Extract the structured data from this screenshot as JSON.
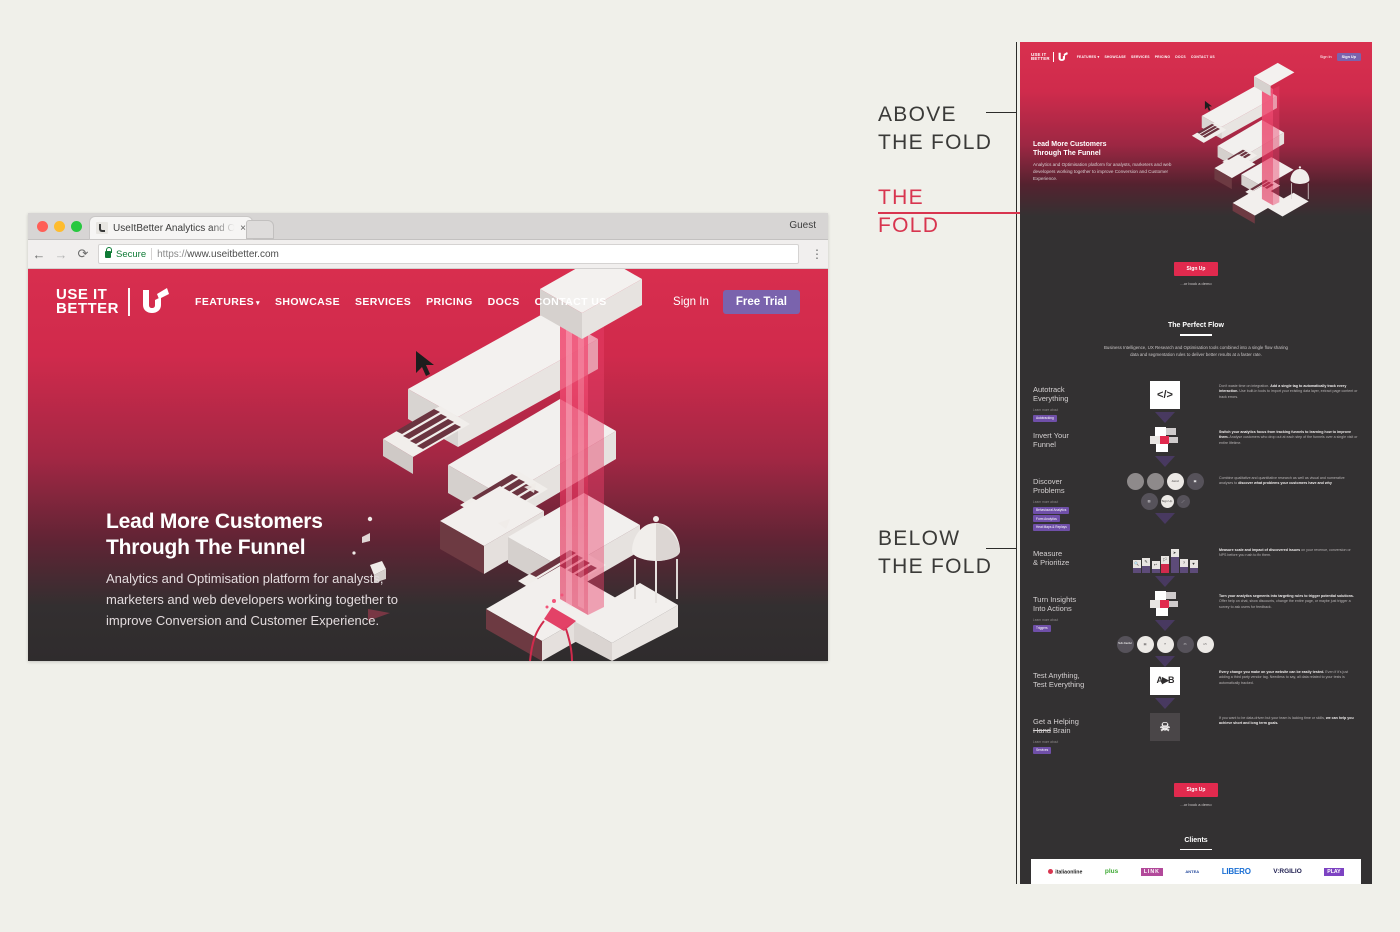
{
  "browser": {
    "tab_title": "UseItBetter Analytics and Opti",
    "tab_close": "×",
    "profile_label": "Guest",
    "back_icon": "←",
    "forward_icon": "→",
    "reload_icon": "⟳",
    "secure_label": "Secure",
    "url_scheme": "https://",
    "url_host": "www.useitbetter.com",
    "menu_icon": "⋮"
  },
  "site": {
    "logo_line1": "USE IT",
    "logo_line2": "BETTER",
    "nav": [
      {
        "label": "FEATURES",
        "has_caret": true
      },
      {
        "label": "SHOWCASE",
        "has_caret": false
      },
      {
        "label": "SERVICES",
        "has_caret": false
      },
      {
        "label": "PRICING",
        "has_caret": false
      },
      {
        "label": "DOCS",
        "has_caret": false
      },
      {
        "label": "CONTACT US",
        "has_caret": false
      }
    ],
    "sign_in": "Sign In",
    "cta_primary": "Free Trial",
    "cta_signup": "Sign Up",
    "hero": {
      "title_line1": "Lead More Customers",
      "title_line2": "Through The Funnel",
      "paragraph": "Analytics and Optimisation platform for analysts, marketers and web developers working together to improve Conversion and Customer Experience."
    }
  },
  "annotations": {
    "above_line1": "ABOVE",
    "above_line2": "THE FOLD",
    "fold_line1": "THE",
    "fold_line2": "FOLD",
    "below_line1": "BELOW",
    "below_line2": "THE FOLD",
    "fold_color": "#d8354f",
    "text_color": "#3a3a38"
  },
  "thumbnail": {
    "cta_button": "Sign Up",
    "cta_sub": "...or book a demo",
    "section_title": "The Perfect Flow",
    "section_sub": "Business Intelligence, UX Research and Optimisation tools combined into a single flow sharing data and segmentation rules to deliver better results at a faster rate.",
    "learn_more": "Learn more about",
    "features": [
      {
        "title_line1": "Autotrack",
        "title_line2": "Everything",
        "has_learn": true,
        "tags": [
          "Autotracking"
        ],
        "icon": "code-icon",
        "icon_glyph": "</>",
        "desc_lead": "Don't waste time on integration.",
        "desc_bold": "Add a single tag to automatically track every interaction.",
        "desc_rest": "Use built-in tools to import your existing data layer, extract page content or track errors."
      },
      {
        "title_line1": "Invert Your",
        "title_line2": "Funnel",
        "has_learn": false,
        "tags": [],
        "icon": "funnel-cart-icon",
        "icon_glyph": "",
        "desc_lead": "",
        "desc_bold": "Switch your analytics focus from tracking funnels to learning how to improve them.",
        "desc_rest": "Analyse customers who drop out at each step of the funnels over a single visit or entire lifetime."
      },
      {
        "title_line1": "Discover",
        "title_line2": "Problems",
        "has_learn": true,
        "tags": [
          "Behavioural Analytics",
          "Form Analytics",
          "Heat Maps & Replays"
        ],
        "icon": "bubble-cluster-icon",
        "icon_glyph": "",
        "desc_lead": "Combine qualitative and quantitative research as well as visual and numerative analyses to",
        "desc_bold": "discover what problems your customers have and why",
        "desc_rest": ""
      },
      {
        "title_line1": "Measure",
        "title_line2": "& Prioritize",
        "has_learn": false,
        "tags": [],
        "icon": "bar-chart-icon",
        "icon_glyph": "",
        "desc_lead": "",
        "desc_bold": "Measure scale and impact of discovered issues",
        "desc_rest": "on your revenue, conversion or NPS before you rush to fix them."
      },
      {
        "title_line1": "Turn Insights",
        "title_line2": "Into Actions",
        "has_learn": true,
        "tags": [
          "Triggers"
        ],
        "icon": "cart-trigger-icon",
        "icon_glyph": "",
        "desc_lead": "",
        "desc_bold": "Turn your analytics segments into targeting rules to trigger potential solutions.",
        "desc_rest": "Offer help on chat, show discounts, change the entire page, or maybe just trigger a survey to ask users for feedback."
      },
      {
        "title_line1": "Test Anything,",
        "title_line2": "Test Everything",
        "has_learn": false,
        "tags": [],
        "icon": "ab-test-icon",
        "icon_glyph": "A B",
        "desc_lead": "",
        "desc_bold": "Every change you make on your website can be easily tested.",
        "desc_rest": "Even if it's just adding a third party vendor tag. Needless to say, all data related to your tests is automatically tracked."
      },
      {
        "title_line1": "Get a Helping",
        "title_line2_strike": "Hand",
        "title_line2_rest": " Brain",
        "has_learn": true,
        "tags": [
          "Services"
        ],
        "icon": "brain-bones-icon",
        "icon_glyph": "",
        "desc_lead": "If you want to be data-driven but your team is lacking time or skills,",
        "desc_bold": "we can help you achieve short and long term goals.",
        "desc_rest": ""
      }
    ],
    "clients_title": "Clients",
    "clients": [
      {
        "name": "italiaonline",
        "label": "italiaonline"
      },
      {
        "name": "plus",
        "label": "plus"
      },
      {
        "name": "link4",
        "label": "LINK"
      },
      {
        "name": "antea",
        "label": "ANTEA"
      },
      {
        "name": "libero",
        "label": "LIBERO"
      },
      {
        "name": "virgilio",
        "label": "V:RGILIO"
      },
      {
        "name": "play",
        "label": "PLAY"
      }
    ],
    "bubbles": [
      "Joind",
      "Sign Up",
      "",
      "",
      "",
      ""
    ],
    "measure_icons": [
      "🔍",
      "✎",
      "↩",
      "🏳",
      "➤",
      "?",
      "♥"
    ],
    "trigger_bubbles": [
      "Hello Davide!",
      "chat",
      "?",
      "💬",
      "</>"
    ]
  }
}
